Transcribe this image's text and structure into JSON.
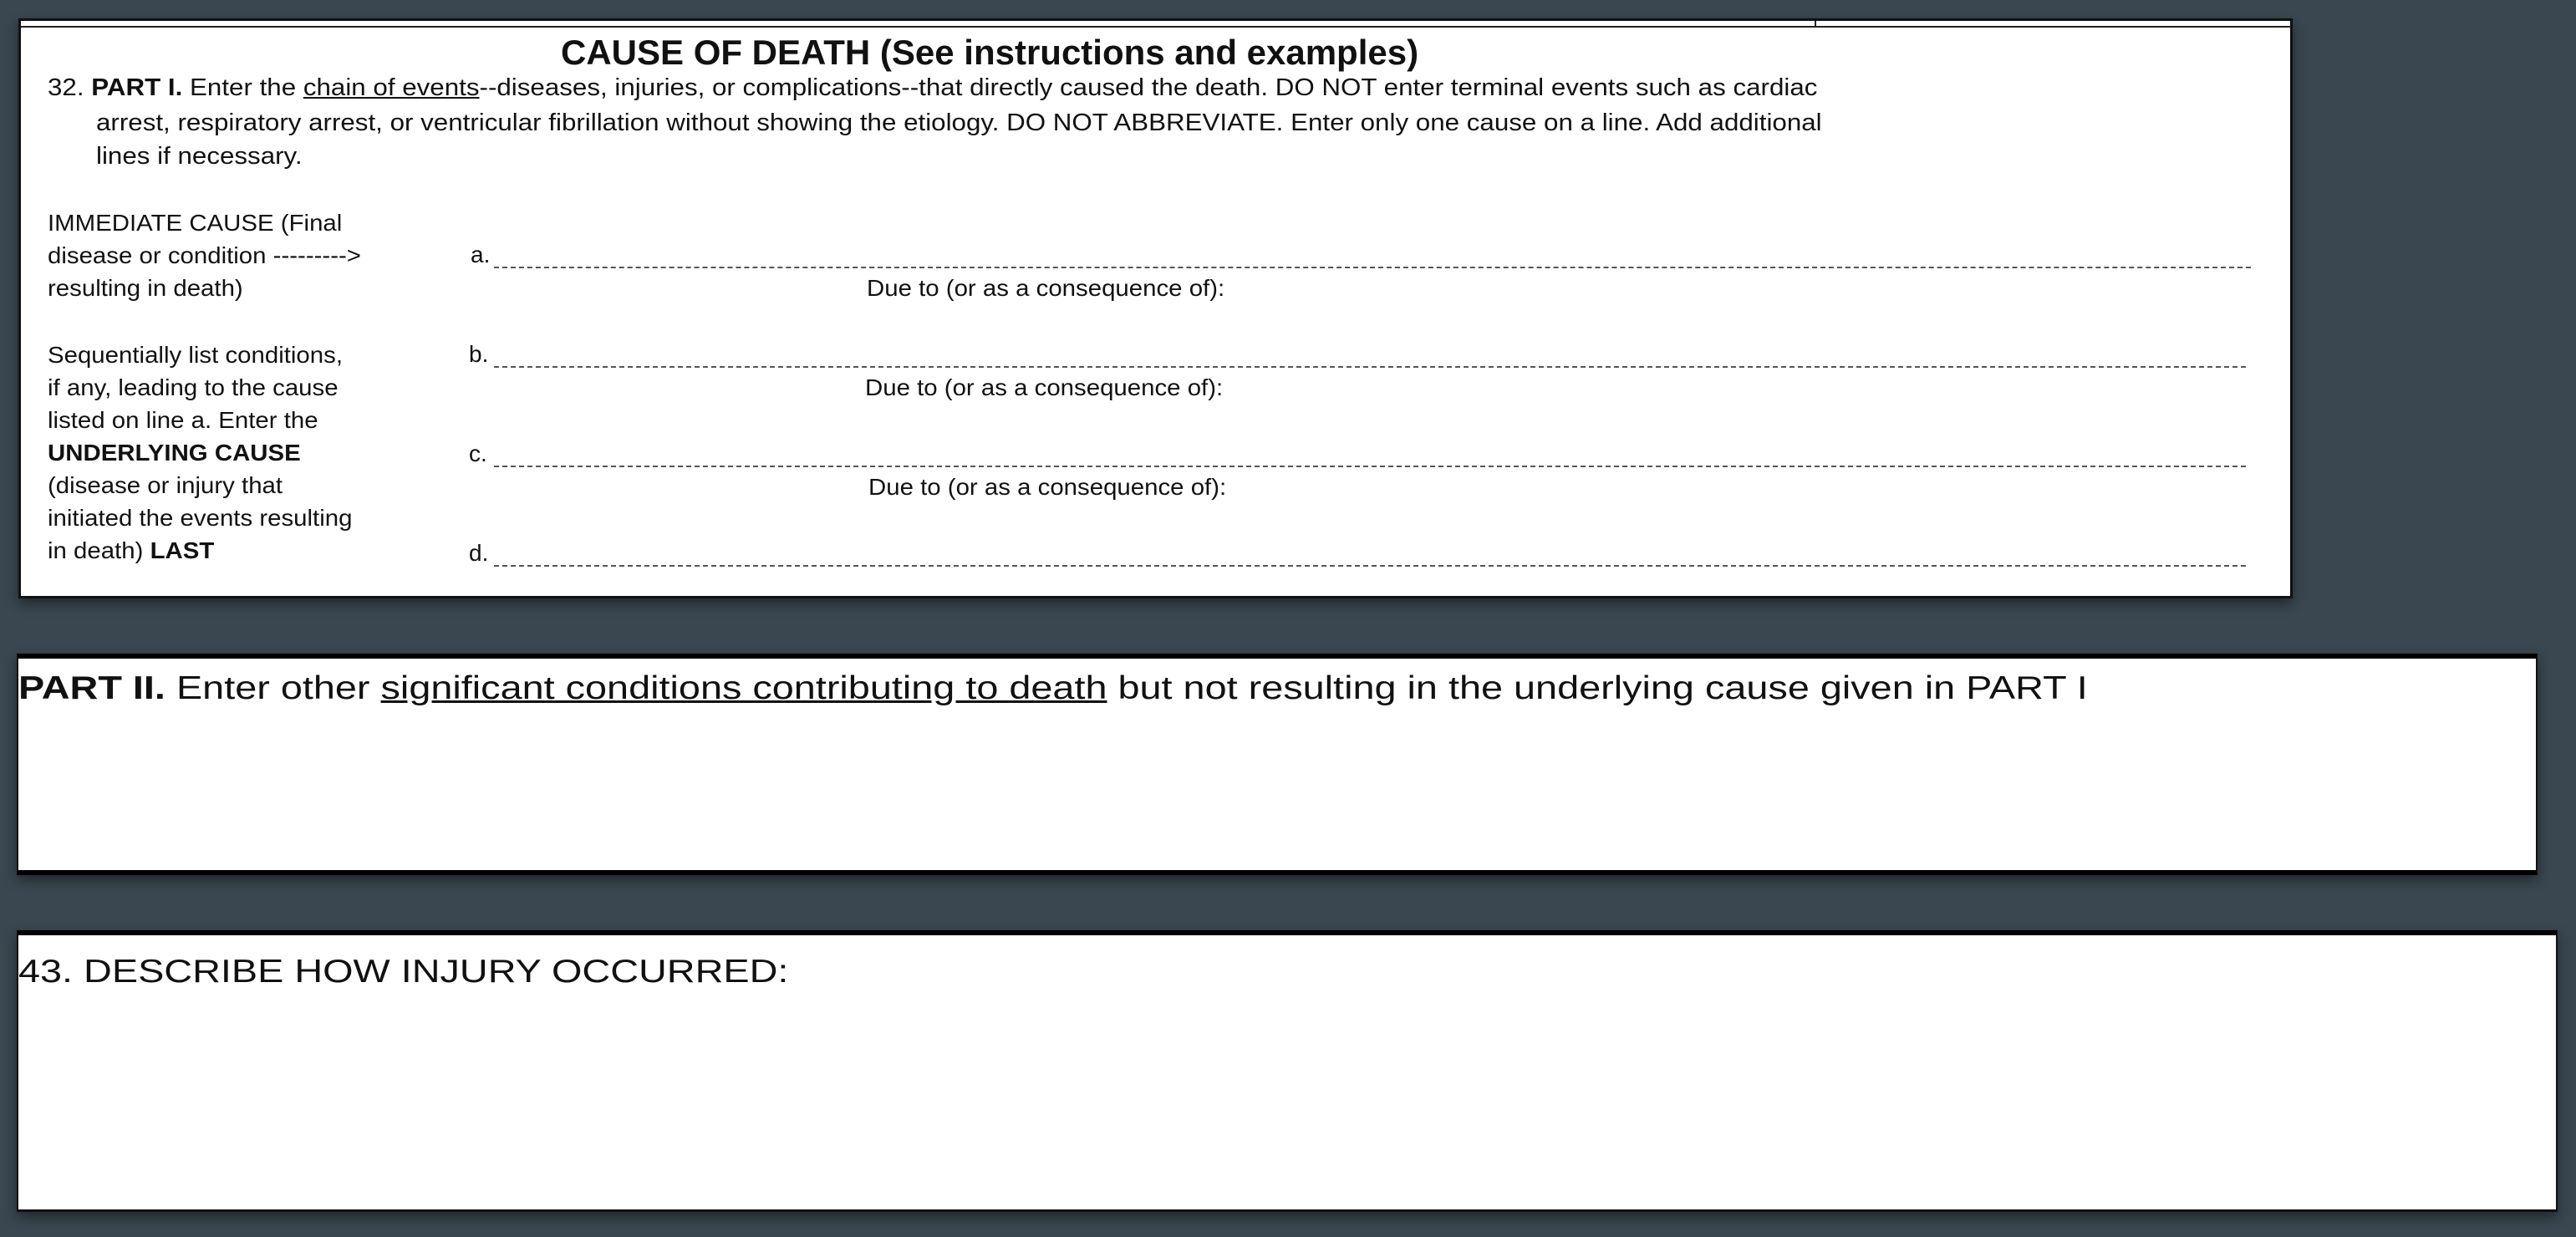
{
  "part1": {
    "title": "CAUSE OF DEATH (See instructions and examples)",
    "number": "32.",
    "part_label": "PART I.",
    "intro_pre": "Enter the",
    "intro_link": "chain of events",
    "intro_post": "--diseases, injuries, or complications--that directly caused the death.  DO NOT enter terminal events such as cardiac",
    "line2": "arrest, respiratory arrest, or ventricular fibrillation without showing the etiology.  DO NOT ABBREVIATE.  Enter only one cause on a line.  Add additional",
    "line3": "lines if necessary.",
    "immediate_label": [
      "IMMEDIATE CAUSE (Final",
      "disease  or condition --------->",
      "resulting  in death)"
    ],
    "sequential_label": [
      "Sequentially list conditions,",
      "if any,  leading to the cause",
      "listed on line a.  Enter the"
    ],
    "underlying_bold": "UNDERLYING CAUSE",
    "underlying_label": [
      "(disease or injury that",
      "initiated the  events resulting",
      "in death)"
    ],
    "last_bold": "LAST",
    "lines": [
      {
        "letter": "a.",
        "value": ""
      },
      {
        "letter": "b.",
        "value": ""
      },
      {
        "letter": "c.",
        "value": ""
      },
      {
        "letter": "d.",
        "value": ""
      }
    ],
    "due_to": "Due to (or as a consequence of):"
  },
  "part2": {
    "label": "PART II.",
    "pre": "Enter other",
    "underlined": "significant conditions contributing to death",
    "post": "but not resulting in the underlying cause given in PART I",
    "value": ""
  },
  "item43": {
    "label": "43.  DESCRIBE HOW INJURY OCCURRED:",
    "value": ""
  }
}
